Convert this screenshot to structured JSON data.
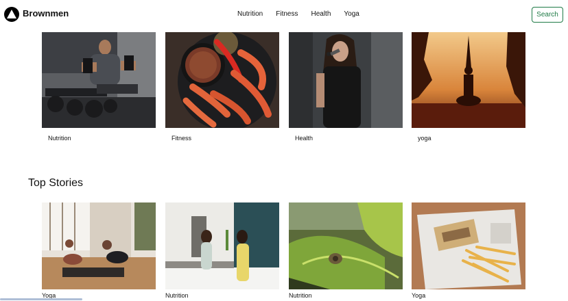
{
  "header": {
    "brand": "Brownmen",
    "nav": [
      "Nutrition",
      "Fitness",
      "Health",
      "Yoga"
    ],
    "search_label": "Search"
  },
  "categories": [
    {
      "label": "Nutrition",
      "image": "man-lifting-dumbbells-photo"
    },
    {
      "label": "Fitness",
      "image": "shrimp-and-spice-dish-photo"
    },
    {
      "label": "Health",
      "image": "woman-singing-microphone-photo"
    },
    {
      "label": "yoga",
      "image": "yoga-silhouette-sunset-photo"
    }
  ],
  "top_stories": {
    "title": "Top Stories",
    "items": [
      {
        "label": "Yoga",
        "image": "women-stretching-studio-photo"
      },
      {
        "label": "Nutrition",
        "image": "women-in-kitchen-photo"
      },
      {
        "label": "Nutrition",
        "image": "snail-on-leaf-photo"
      },
      {
        "label": "Yoga",
        "image": "food-magazine-fries-photo"
      }
    ]
  },
  "colors": {
    "accent": "#1e7a45"
  }
}
